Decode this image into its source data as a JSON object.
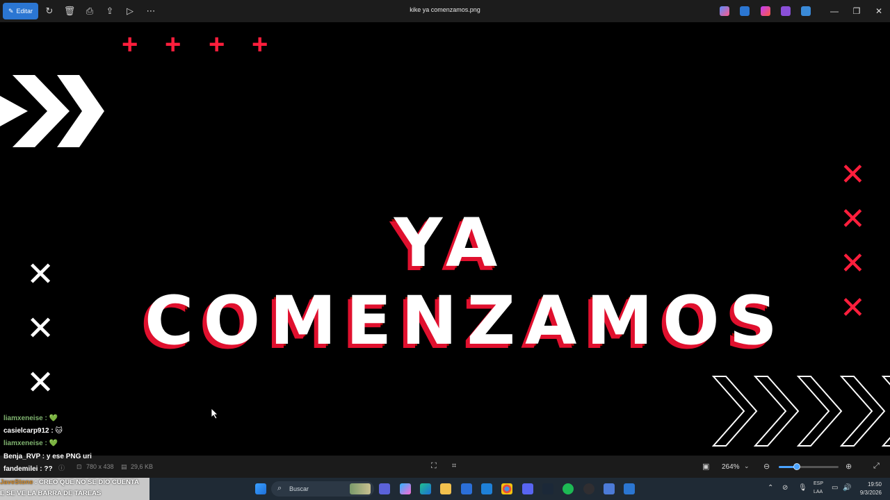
{
  "toolbar": {
    "edit_label": "Editar",
    "window_title": "kike ya comenzamos.png"
  },
  "canvas": {
    "headline": "YA COMENZAMOS",
    "colors": {
      "accent_red": "#ff1e3c",
      "background": "#000000"
    }
  },
  "chat": {
    "lines": [
      {
        "user": "liamxeneise",
        "sep": " :",
        "msg": " 💚"
      },
      {
        "user": "casielcarp912",
        "sep": " :",
        "msg": " 🐱"
      },
      {
        "user": "liamxeneise",
        "sep": " :",
        "msg": " 💚"
      },
      {
        "user": "Benja_RVP",
        "sep": " :",
        "msg": " y ese PNG uri"
      },
      {
        "user": "fandemilei",
        "sep": " :",
        "msg": " ??"
      }
    ],
    "bottom_user": "JaveStone",
    "bottom_msg1": " : CREO QUE NO SE DIO CUENTA",
    "bottom_msg2": "E SE VE LA BARRA DE TAREAS"
  },
  "statusbar": {
    "dimensions": "780 x 438",
    "file_size": "29,6 KB",
    "zoom": "264%",
    "zoom_level": 0.3
  },
  "taskbar": {
    "search_placeholder": "Buscar",
    "lang_top": "ESP",
    "lang_bottom": "LAA",
    "time": "19:50",
    "date": "9/3/2026"
  }
}
